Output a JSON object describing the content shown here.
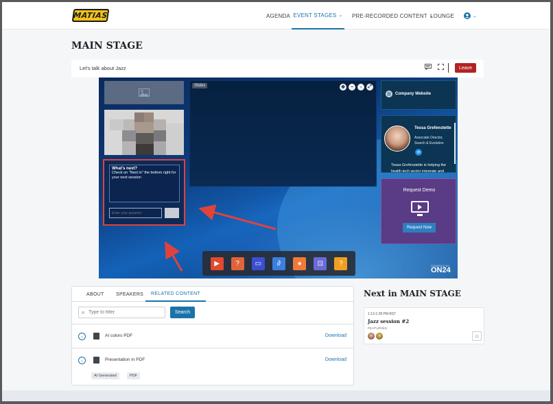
{
  "nav": {
    "logo": "MATIAS",
    "items": [
      {
        "label": "AGENDA",
        "chevron": false,
        "active": false
      },
      {
        "label": "EVENT STAGES",
        "chevron": true,
        "active": true
      },
      {
        "label": "PRE-RECORDED CONTENT",
        "chevron": true,
        "active": false
      },
      {
        "label": "LOUNGE",
        "chevron": false,
        "active": false
      }
    ],
    "user_icon": "user-circle-icon"
  },
  "page": {
    "title": "MAIN STAGE"
  },
  "session": {
    "title": "Let's talk about Jazz",
    "leave_label": "Leave",
    "icons": [
      "chat-icon",
      "fullscreen-icon"
    ]
  },
  "stage": {
    "qa": {
      "heading": "What's next?",
      "text": "Check on \"Next in\" the bottom right for your next session",
      "placeholder": "Enter your question"
    },
    "slides_label": "Slides",
    "company_label": "Company Website",
    "speaker": {
      "name": "Tessa Grefenstette",
      "role": "Associate Director, Search & Evolution",
      "bio": "Tessa Grefenstette is helping the health tech sector integrate and"
    },
    "demo": {
      "title": "Request Demo",
      "button": "Request Now"
    },
    "dock_icons": [
      {
        "name": "play-icon",
        "color": "#e04a2f",
        "glyph": "▶"
      },
      {
        "name": "qa-icon",
        "color": "#e0633a",
        "glyph": "?"
      },
      {
        "name": "presentation-icon",
        "color": "#3b4fd0",
        "glyph": "▭"
      },
      {
        "name": "attachment-icon",
        "color": "#3b7fe0",
        "glyph": "∂"
      },
      {
        "name": "profile-icon",
        "color": "#f07a3a",
        "glyph": "●"
      },
      {
        "name": "screenshare-icon",
        "color": "#6a6ad8",
        "glyph": "⊡"
      },
      {
        "name": "help-icon",
        "color": "#f0a020",
        "glyph": "?"
      }
    ],
    "brand": {
      "powered_by": "POWERED BY",
      "name": "ON24"
    }
  },
  "tabs": [
    {
      "label": "ABOUT",
      "active": false
    },
    {
      "label": "SPEAKERS",
      "active": false
    },
    {
      "label": "RELATED CONTENT",
      "active": true
    }
  ],
  "filter": {
    "placeholder": "Type to filter",
    "search_label": "Search"
  },
  "related": [
    {
      "name": "AI colors PDF",
      "download": "Download",
      "tags": []
    },
    {
      "name": "Presentation in PDF",
      "download": "Download",
      "tags": [
        "AI Generated",
        "PDF"
      ]
    }
  ],
  "next": {
    "heading": "Next in MAIN STAGE",
    "time": "1:13-1:28 PM BST",
    "session": "Jazz session #2",
    "featuring": "FEATURING"
  },
  "colors": {
    "accent": "#1a73a8",
    "leave": "#b22222",
    "arrow": "#e0433a"
  }
}
